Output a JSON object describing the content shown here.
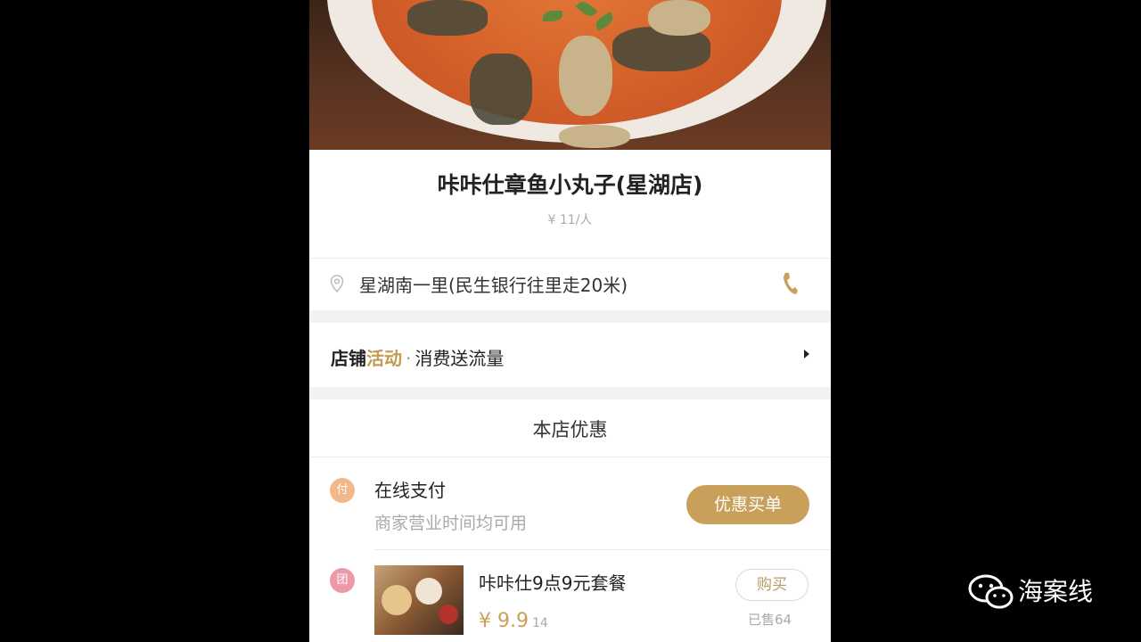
{
  "shop": {
    "name": "咔咔仕章鱼小丸子(星湖店)",
    "price_per_person": "¥ 11/人",
    "address": "星湖南一里(民生银行往里走20米)"
  },
  "activity": {
    "label_prefix": "店铺",
    "label_highlight": "活动",
    "separator": "·",
    "description": "消费送流量"
  },
  "deals": {
    "section_title": "本店优惠",
    "online_pay": {
      "badge": "付",
      "title": "在线支付",
      "subtitle": "商家营业时间均可用",
      "button_label": "优惠买单"
    },
    "combo": {
      "badge": "团",
      "title": "咔咔仕9点9元套餐",
      "price": "¥ 9.9",
      "original_price": "14",
      "button_label": "购买",
      "sold": "已售64"
    }
  },
  "watermark": {
    "text": "海案线",
    "icon": "wechat-icon"
  },
  "colors": {
    "accent_gold": "#c8a05a",
    "page_background": "#000000"
  }
}
